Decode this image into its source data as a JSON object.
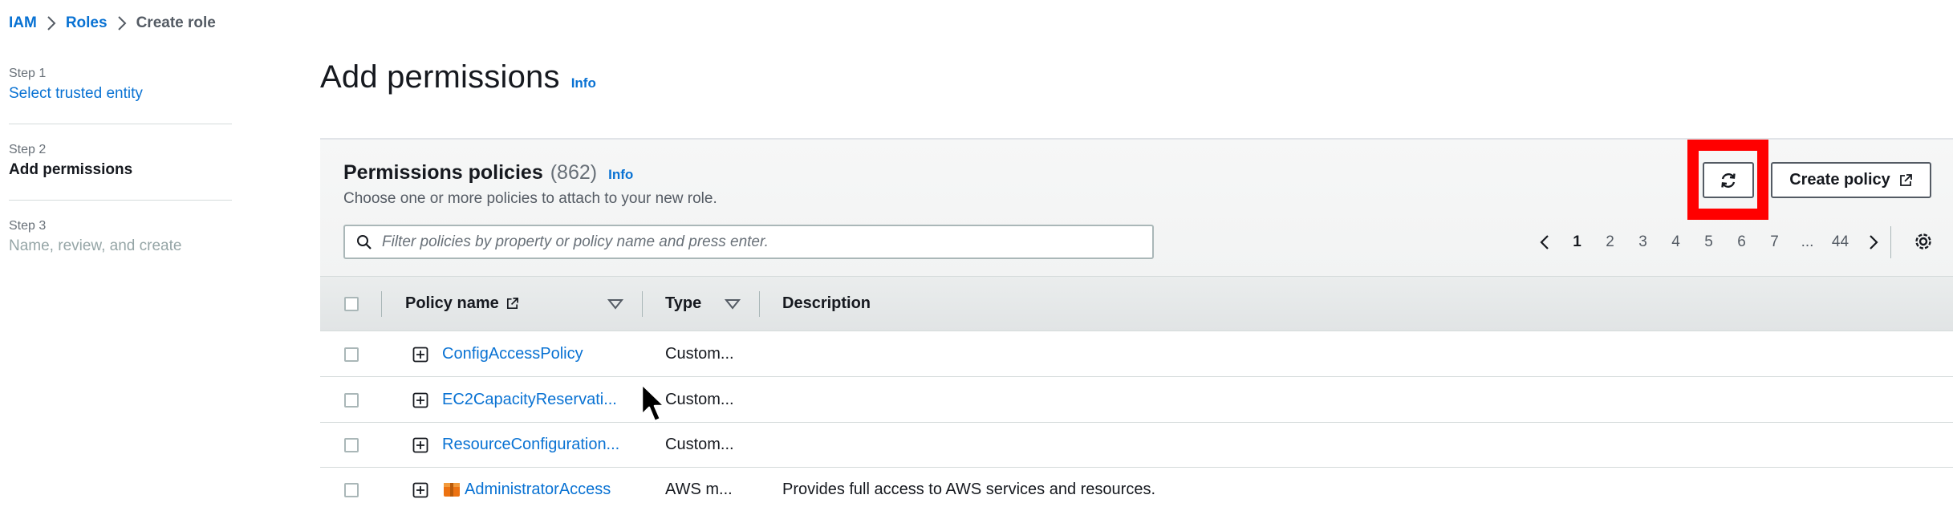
{
  "breadcrumb": {
    "items": [
      {
        "label": "IAM"
      },
      {
        "label": "Roles"
      },
      {
        "label": "Create role"
      }
    ]
  },
  "steps": [
    {
      "num": "Step 1",
      "label": "Select trusted entity"
    },
    {
      "num": "Step 2",
      "label": "Add permissions"
    },
    {
      "num": "Step 3",
      "label": "Name, review, and create"
    }
  ],
  "page": {
    "title": "Add permissions",
    "info": "Info"
  },
  "policies": {
    "title": "Permissions policies",
    "count": "(862)",
    "info": "Info",
    "subtitle": "Choose one or more policies to attach to your new role.",
    "create_label": "Create policy",
    "search_placeholder": "Filter policies by property or policy name and press enter.",
    "pagination": {
      "pages": [
        "1",
        "2",
        "3",
        "4",
        "5",
        "6",
        "7",
        "...",
        "44"
      ],
      "current": "1"
    },
    "columns": {
      "name": "Policy name",
      "type": "Type",
      "description": "Description"
    },
    "rows": [
      {
        "name": "ConfigAccessPolicy",
        "type": "Custom...",
        "description": "",
        "aws_managed": false
      },
      {
        "name": "EC2CapacityReservati...",
        "type": "Custom...",
        "description": "",
        "aws_managed": false
      },
      {
        "name": "ResourceConfiguration...",
        "type": "Custom...",
        "description": "",
        "aws_managed": false
      },
      {
        "name": "AdministratorAccess",
        "type": "AWS m...",
        "description": "Provides full access to AWS services and resources.",
        "aws_managed": true
      }
    ]
  },
  "icons": {
    "refresh": "refresh-icon",
    "external_link": "external-link-icon",
    "search": "search-icon",
    "settings": "gear-icon",
    "expand": "plus-square-icon",
    "aws_managed": "aws-package-icon"
  },
  "colors": {
    "link": "#0972d3",
    "highlight": "#ff0000",
    "aws_orange": "#ec7211"
  }
}
